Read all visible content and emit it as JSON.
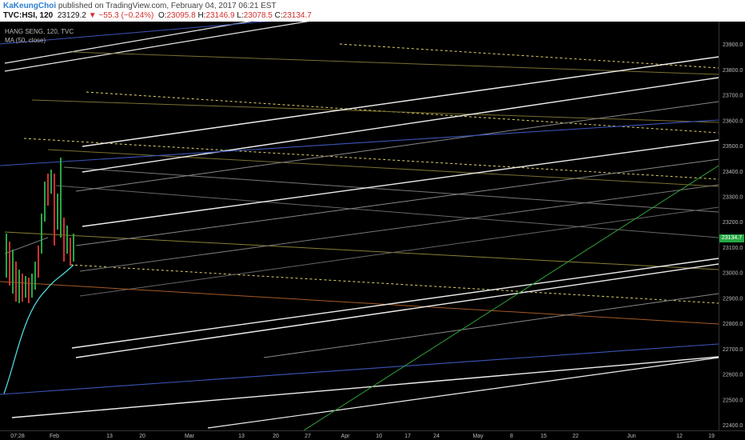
{
  "header": {
    "author": "KaKeungChoi",
    "published": "published on TradingView.com, February 04, 2017 06:21 EST",
    "symbol": "TVC:HSI, 120",
    "last": "23129.2",
    "change_arrow": "▼",
    "change": "−55.3 (−0.24%)",
    "open_label": "O:",
    "open": "23095.8",
    "high_label": "H:",
    "high": "23146.9",
    "low_label": "L:",
    "low": "23078.5",
    "close_label": "C:",
    "close": "23134.7"
  },
  "legend": {
    "series": "HANG SENG, 120, TVC",
    "indicator": "MA (50, close)"
  },
  "colors": {
    "background": "#000000",
    "price_tag": "#27a844",
    "down": "#d0312d",
    "up": "#27a844",
    "ma": "#4fd3d6",
    "author": "#2d7fd2"
  },
  "chart_data": {
    "type": "line",
    "y_ticks": [
      "23900.0",
      "23800.0",
      "23700.0",
      "23600.0",
      "23500.0",
      "23400.0",
      "23300.0",
      "23200.0",
      "23100.0",
      "23000.0",
      "22900.0",
      "22800.0",
      "22700.0",
      "22600.0",
      "22500.0",
      "22400.0"
    ],
    "x_ticks": [
      "07:28",
      "Feb",
      "13",
      "20",
      "Mar",
      "13",
      "20",
      "27",
      "Apr",
      "10",
      "17",
      "24",
      "May",
      "8",
      "15",
      "22",
      "Jun",
      "12",
      "19"
    ],
    "last_price": "23134.7",
    "ylim": [
      22380,
      23990
    ]
  }
}
